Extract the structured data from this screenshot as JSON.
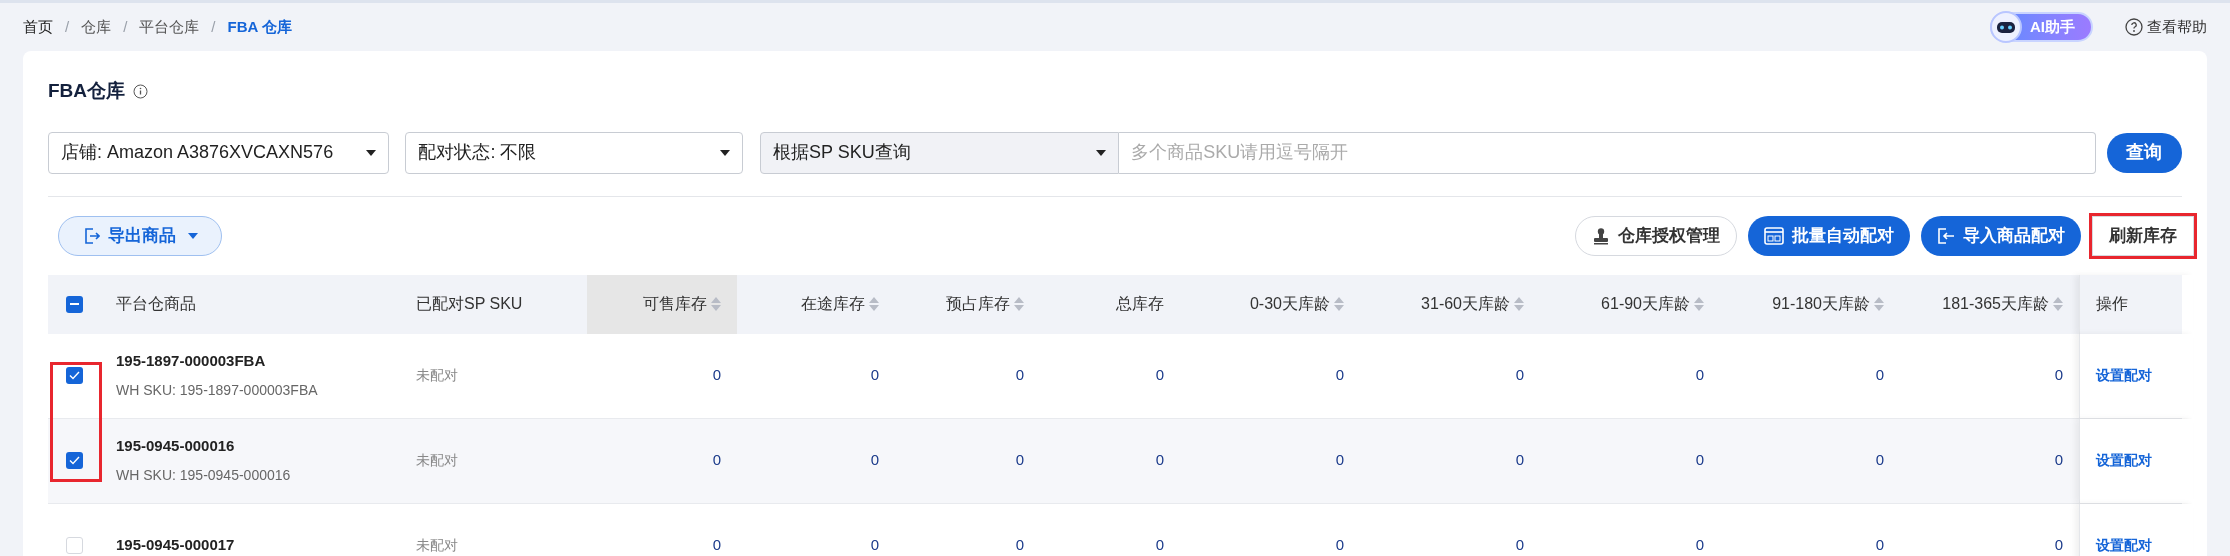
{
  "breadcrumb_separator": "/",
  "breadcrumb": [
    {
      "label": "首页",
      "current": false
    },
    {
      "label": "仓库",
      "current": false
    },
    {
      "label": "平台仓库",
      "current": false
    },
    {
      "label": "FBA 仓库",
      "current": true
    }
  ],
  "top_actions": {
    "ai_assistant": "AI助手",
    "help": "查看帮助"
  },
  "page_title": "FBA仓库",
  "filters": {
    "store": "店铺: Amazon A3876XVCAXN576",
    "pair_status": "配对状态: 不限",
    "search_by": "根据SP SKU查询",
    "search_placeholder": "多个商品SKU请用逗号隔开",
    "search_button": "查询"
  },
  "toolbar": {
    "export": "导出商品",
    "buttons": [
      {
        "label": "仓库授权管理",
        "kind": "outline",
        "highlighted": false
      },
      {
        "label": "批量自动配对",
        "kind": "primary",
        "highlighted": false
      },
      {
        "label": "导入商品配对",
        "kind": "primary",
        "highlighted": false
      },
      {
        "label": "刷新库存",
        "kind": "outline",
        "highlighted": true
      }
    ]
  },
  "table": {
    "select_all": {
      "indeterminate": true
    },
    "columns": [
      {
        "label": "平台仓商品",
        "sortable": false,
        "selected": false
      },
      {
        "label": "已配对SP SKU",
        "sortable": false,
        "selected": false
      },
      {
        "label": "可售库存",
        "sortable": true,
        "selected": true
      },
      {
        "label": "在途库存",
        "sortable": true,
        "selected": false
      },
      {
        "label": "预占库存",
        "sortable": true,
        "selected": false
      },
      {
        "label": "总库存",
        "sortable": false,
        "selected": false
      },
      {
        "label": "0-30天库龄",
        "sortable": true,
        "selected": false
      },
      {
        "label": "31-60天库龄",
        "sortable": true,
        "selected": false
      },
      {
        "label": "61-90天库龄",
        "sortable": true,
        "selected": false
      },
      {
        "label": "91-180天库龄",
        "sortable": true,
        "selected": false
      },
      {
        "label": "181-365天库龄",
        "sortable": true,
        "selected": false
      },
      {
        "label": "操作",
        "sortable": false,
        "selected": false
      }
    ],
    "rows": [
      {
        "checked": true,
        "product": "195-1897-000003FBA",
        "wh_sku": "WH SKU: 195-1897-000003FBA",
        "paired": "未配对",
        "values": [
          "0",
          "0",
          "0",
          "0",
          "0",
          "0",
          "0",
          "0",
          "0"
        ],
        "action": "设置配对"
      },
      {
        "checked": true,
        "product": "195-0945-000016",
        "wh_sku": "WH SKU: 195-0945-000016",
        "paired": "未配对",
        "values": [
          "0",
          "0",
          "0",
          "0",
          "0",
          "0",
          "0",
          "0",
          "0"
        ],
        "action": "设置配对"
      },
      {
        "checked": false,
        "product": "195-0945-000017",
        "paired": "未配对",
        "values": [
          "0",
          "0",
          "0",
          "0",
          "0",
          "0",
          "0",
          "0",
          "0"
        ],
        "action": "设置配对"
      }
    ],
    "highlight_selected_checkboxes": true
  }
}
